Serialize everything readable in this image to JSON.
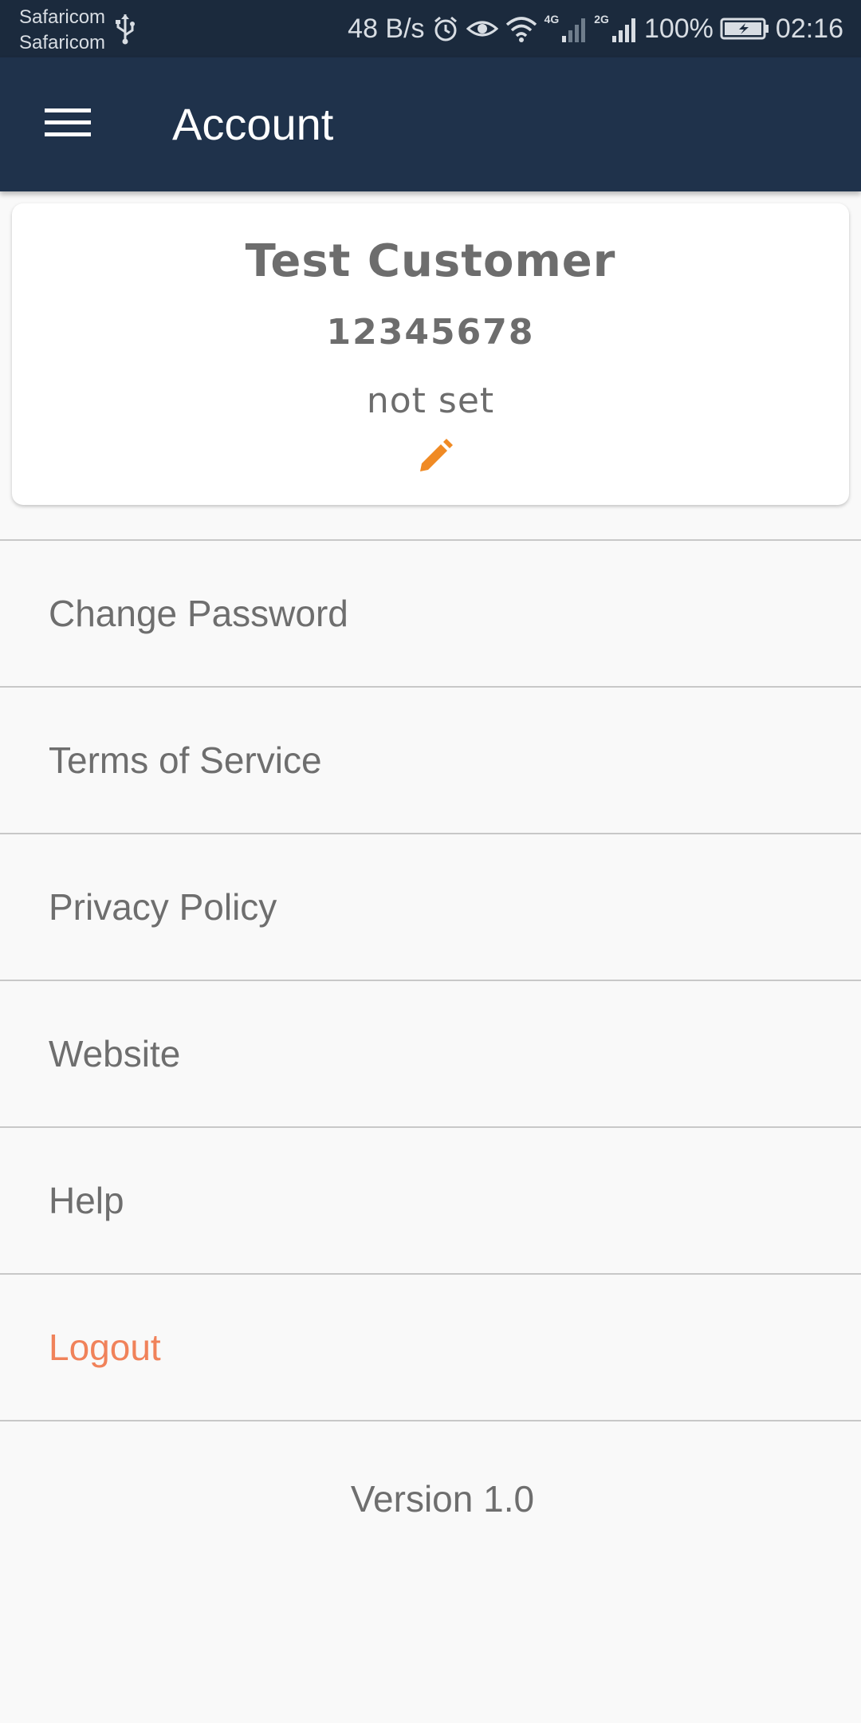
{
  "status_bar": {
    "carrier_1": "Safaricom",
    "carrier_2": "Safaricom",
    "net_speed": "48 B/s",
    "net_4g": "4G",
    "net_2g": "2G",
    "battery": "100%",
    "time": "02:16",
    "icons": [
      "usb-icon",
      "alarm-icon",
      "eye-icon",
      "wifi-icon",
      "signal-icon",
      "battery-icon"
    ]
  },
  "app_bar": {
    "title": "Account",
    "menu_icon": "hamburger-menu-icon",
    "background": "#1f324b"
  },
  "profile": {
    "name": "Test Customer",
    "number": "12345678",
    "email": "not set",
    "edit_icon": "pencil-icon",
    "accent": "#f08a24"
  },
  "menu": {
    "items": [
      {
        "label": "Change Password"
      },
      {
        "label": "Terms of Service"
      },
      {
        "label": "Privacy Policy"
      },
      {
        "label": "Website"
      },
      {
        "label": "Help"
      },
      {
        "label": "Logout"
      }
    ],
    "logout_color": "#f0825a"
  },
  "footer": {
    "version": "Version 1.0"
  }
}
